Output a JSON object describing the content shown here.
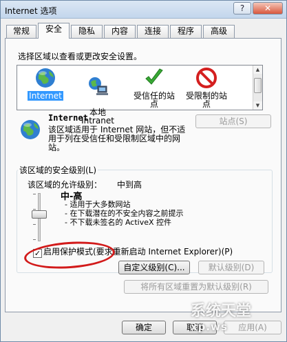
{
  "window": {
    "title": "Internet 选项",
    "help_label": "?",
    "close_label": "✕"
  },
  "tabs": [
    {
      "label": "常规"
    },
    {
      "label": "安全"
    },
    {
      "label": "隐私"
    },
    {
      "label": "内容"
    },
    {
      "label": "连接"
    },
    {
      "label": "程序"
    },
    {
      "label": "高级"
    }
  ],
  "security": {
    "zone_caption": "选择区域以查看或更改安全设置。",
    "zones": [
      {
        "label": "Internet",
        "icon": "globe-icon"
      },
      {
        "label": "本地\nIntranet",
        "icon": "network-icon"
      },
      {
        "label": "受信任的站\n点",
        "icon": "checkmark-icon"
      },
      {
        "label": "受限制的站\n点",
        "icon": "prohibited-icon"
      }
    ],
    "info": {
      "title": "Internet",
      "description": "该区域适用于 Internet 网站，但不适用于列在受信任和受限制区域中的网站。",
      "sites_button": "站点(S)"
    },
    "level": {
      "legend": "该区域的安全级别(L)",
      "allowed_label": "该区域的允许级别：",
      "allowed_value": "中到高",
      "name": "中-高",
      "bullets": [
        "- 适用于大多数网站",
        "- 在下载潜在的不安全内容之前提示",
        "- 不下载未签名的 ActiveX 控件"
      ],
      "protected_mode_label": "启用保护模式(要求重新启动 Internet Explorer)(P)",
      "protected_mode_checked": "✓",
      "custom_button": "自定义级别(C)...",
      "default_button": "默认级别(D)"
    },
    "reset_all_button": "将所有区域重置为默认级别(R)"
  },
  "footer": {
    "ok": "确定",
    "cancel": "取消",
    "apply": "应用(A)"
  },
  "watermark": {
    "line1": "系统天堂",
    "line2": "xp.ws"
  },
  "colors": {
    "selection": "#3399ff",
    "highlight": "#d21a1a"
  }
}
